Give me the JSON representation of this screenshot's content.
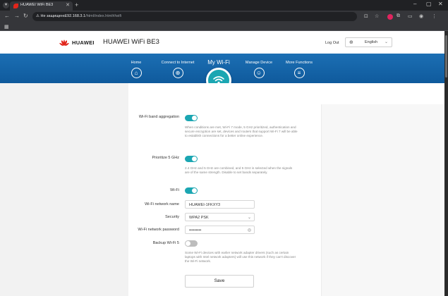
{
  "browser": {
    "tab_title": "HUAWEI WiFi BE3",
    "security_label": "Не защищено",
    "url_host": "192.168.3.1",
    "url_path": "/html/index.html#/wifi"
  },
  "header": {
    "brand": "HUAWEI",
    "product": "HUAWEI WiFi BE3",
    "logout": "Log Out",
    "language": "English"
  },
  "nav": {
    "home": "Home",
    "connect": "Connect to Internet",
    "mywifi": "My Wi-Fi",
    "manage": "Manage Device",
    "more": "More Functions"
  },
  "settings": {
    "band_aggregation_label": "Wi-Fi band aggregation",
    "band_aggregation_on": true,
    "band_aggregation_desc": "When conditions are met, Wi-Fi 7 mode, 5 GHz prioritized, authentication and secure encryption are set, devices and routers that support Wi-Fi 7 will be able to establish connections for a better online experience.",
    "prioritize_label": "Prioritize 5 GHz",
    "prioritize_on": true,
    "prioritize_desc": "2.4 GHz and 5 GHz are combined, and 5 GHz is selected when the signals are of the same strength. Disable to set bands separately.",
    "wifi_label": "Wi-Fi",
    "wifi_on": true,
    "network_name_label": "Wi-Fi network name",
    "network_name_value": "HUAWEI-1FKXY3",
    "security_label": "Security",
    "security_value": "WPA2 PSK",
    "password_label": "Wi-Fi network password",
    "password_value": "•••••••••",
    "backup_label": "Backup Wi-Fi 5",
    "backup_on": false,
    "backup_desc": "Some Wi-Fi devices with earlier network adapter drivers (such as certain laptops with Intel network adapters) will use this network if they can't discover the Wi-Fi network.",
    "save_label": "Save"
  },
  "colors": {
    "accent": "#1ba6b2",
    "nav_blue": "#1c6fb4",
    "huawei_red": "#e1251b"
  }
}
